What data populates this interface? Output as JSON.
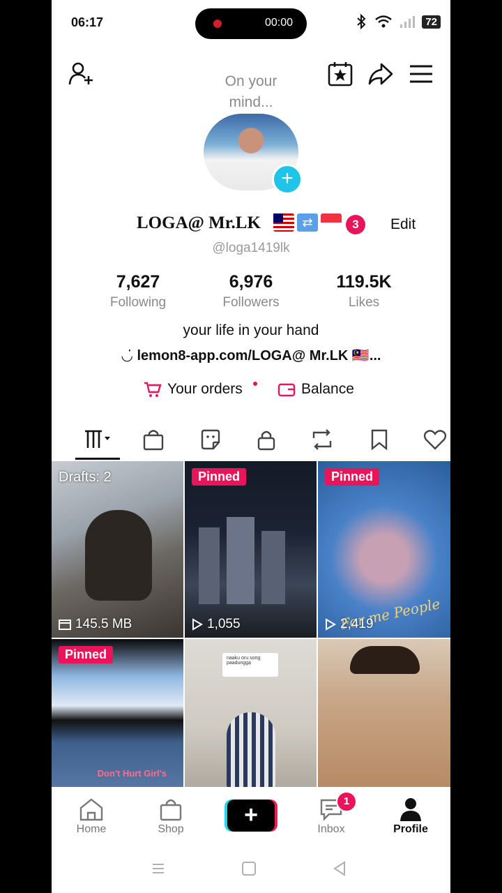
{
  "status_bar": {
    "time": "06:17",
    "recording_time": "00:00",
    "battery": "72"
  },
  "header": {
    "mind_text": "On your mind...",
    "icons": [
      "add-friend-icon",
      "calendar-star-icon",
      "share-icon",
      "menu-icon"
    ]
  },
  "profile": {
    "name": "LOGA@ Mr.LK",
    "notification_count": "3",
    "edit_label": "Edit",
    "handle": "@loga1419lk",
    "stats": [
      {
        "value": "7,627",
        "label": "Following"
      },
      {
        "value": "6,976",
        "label": "Followers"
      },
      {
        "value": "119.5K",
        "label": "Likes"
      }
    ],
    "bio": "your life in your hand",
    "link": "lemon8-app.com/LOGA@ Mr.LK 🇲🇾..."
  },
  "actions": {
    "orders_label": "Your orders",
    "balance_label": "Balance"
  },
  "tabs": [
    "videos-grid-icon",
    "shop-bag-icon",
    "sticker-icon",
    "lock-icon",
    "repost-icon",
    "bookmark-icon",
    "heart-icon"
  ],
  "grid": [
    {
      "badge": "Drafts: 2",
      "meta": "145.5 MB",
      "meta_icon": "drafts-box-icon"
    },
    {
      "badge": "Pinned",
      "meta": "1,055",
      "meta_icon": "play-icon"
    },
    {
      "badge": "Pinned",
      "meta": "2,419",
      "meta_icon": "play-icon",
      "overlay_text": "For me People"
    },
    {
      "badge": "Pinned",
      "meta": "",
      "overlay_text": "Don't Hurt Girl's"
    },
    {
      "badge": "",
      "meta": "",
      "overlay_text": "naaku oru song paadungga"
    },
    {
      "badge": "",
      "meta": ""
    }
  ],
  "bottom_nav": {
    "home": "Home",
    "shop": "Shop",
    "inbox": "Inbox",
    "inbox_badge": "1",
    "profile": "Profile"
  },
  "colors": {
    "accent": "#e8155a",
    "cyan": "#25d7e8",
    "text": "#111111",
    "muted": "#8a8a8a"
  }
}
